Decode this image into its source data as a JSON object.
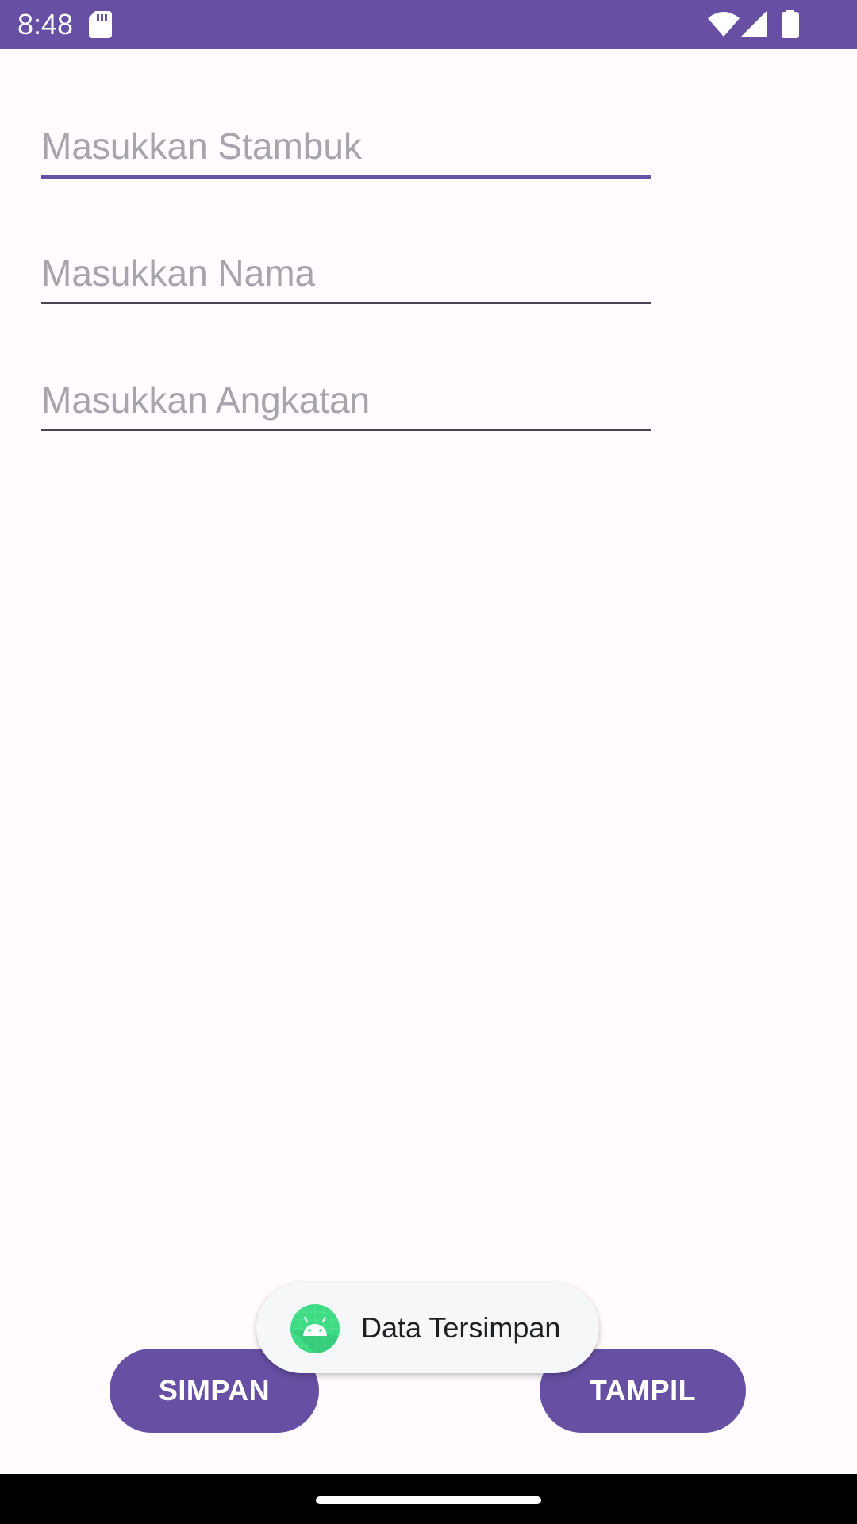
{
  "status_bar": {
    "time": "8:48",
    "icons": [
      "sd-card-icon",
      "wifi-icon",
      "signal-icon",
      "battery-icon"
    ],
    "background_color": "#6750A4"
  },
  "form": {
    "stambuk": {
      "value": "",
      "placeholder": "Masukkan Stambuk",
      "focused": true
    },
    "nama": {
      "value": "",
      "placeholder": "Masukkan Nama"
    },
    "angkatan": {
      "value": "",
      "placeholder": "Masukkan Angkatan"
    }
  },
  "buttons": {
    "simpan_label": "SIMPAN",
    "tampil_label": "TAMPIL"
  },
  "toast": {
    "icon": "android-icon",
    "message": "Data Tersimpan"
  },
  "colors": {
    "primary": "#6750A4",
    "background": "#FFFBFE",
    "placeholder": "#A7A4AB",
    "underline": "#49454F"
  }
}
